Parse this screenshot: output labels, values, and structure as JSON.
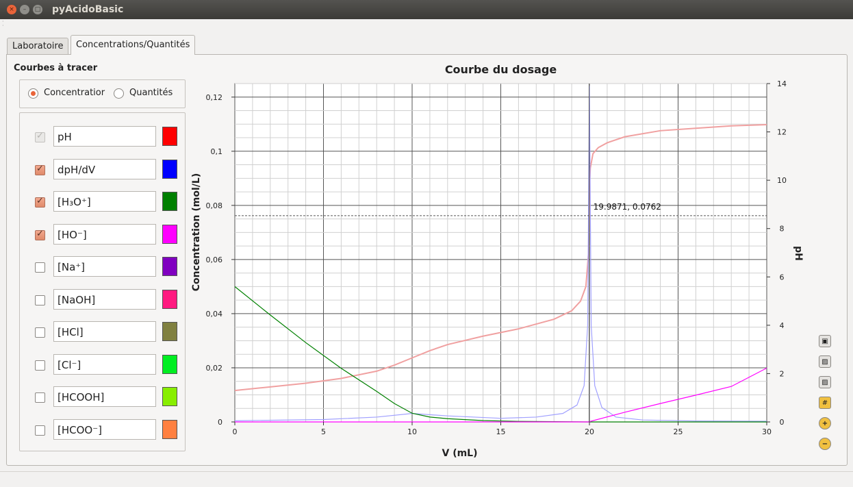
{
  "window": {
    "title": "pyAcidoBasic",
    "close": "×",
    "minimize": "–",
    "maximize": "□"
  },
  "tabs": [
    {
      "label": "Laboratoire",
      "active": false
    },
    {
      "label": "Concentrations/Quantités",
      "active": true
    }
  ],
  "sidebar": {
    "title": "Courbes à tracer",
    "mode": {
      "concentration_label": "Concentratior",
      "quantites_label": "Quantités",
      "selected": "concentration"
    },
    "curves": [
      {
        "label": "pH",
        "checked": true,
        "disabled": true,
        "color": "#ff0000"
      },
      {
        "label": "dpH/dV",
        "checked": true,
        "disabled": false,
        "color": "#0000ff"
      },
      {
        "label": "[H₃O⁺]",
        "checked": true,
        "disabled": false,
        "color": "#008000"
      },
      {
        "label": "[HO⁻]",
        "checked": true,
        "disabled": false,
        "color": "#ff00ff"
      },
      {
        "label": "[Na⁺]",
        "checked": false,
        "disabled": false,
        "color": "#8000c0"
      },
      {
        "label": "[NaOH]",
        "checked": false,
        "disabled": false,
        "color": "#ff1a80"
      },
      {
        "label": "[HCl]",
        "checked": false,
        "disabled": false,
        "color": "#808040"
      },
      {
        "label": "[Cl⁻]",
        "checked": false,
        "disabled": false,
        "color": "#00ee22"
      },
      {
        "label": "[HCOOH]",
        "checked": false,
        "disabled": false,
        "color": "#88ee00"
      },
      {
        "label": "[HCOO⁻]",
        "checked": false,
        "disabled": false,
        "color": "#ff8040"
      }
    ]
  },
  "chart_data": {
    "type": "line",
    "title": "Courbe du dosage",
    "xlabel": "V (mL)",
    "ylabel": "Concentration (mol/L)",
    "y2label": "pH",
    "xlim": [
      0,
      30
    ],
    "ylim": [
      0,
      0.125
    ],
    "y2lim": [
      0,
      14
    ],
    "xticks": [
      0,
      5,
      10,
      15,
      20,
      25,
      30
    ],
    "yticks": [
      0,
      0.02,
      0.04,
      0.06,
      0.08,
      0.1,
      0.12
    ],
    "ytick_labels": [
      "0",
      "0,02",
      "0,04",
      "0,06",
      "0,08",
      "0,1",
      "0,12"
    ],
    "y2ticks": [
      0,
      2,
      4,
      6,
      8,
      10,
      12,
      14
    ],
    "grid": true,
    "cursor": {
      "x": 19.9871,
      "y": 0.0762,
      "label": "19.9871, 0.0762"
    },
    "series": [
      {
        "color": "#f0a0a0",
        "axis": "y2",
        "x": [
          0,
          2,
          4,
          6,
          8,
          9,
          10,
          11,
          12,
          14,
          16,
          18,
          19,
          19.5,
          19.8,
          19.95,
          20,
          20.05,
          20.2,
          20.5,
          21,
          22,
          24,
          26,
          28,
          30
        ],
        "values": [
          1.3,
          1.45,
          1.6,
          1.8,
          2.1,
          2.35,
          2.65,
          2.95,
          3.2,
          3.55,
          3.85,
          4.25,
          4.6,
          5.0,
          5.6,
          7.0,
          9.7,
          10.5,
          11.1,
          11.35,
          11.55,
          11.8,
          12.05,
          12.15,
          12.25,
          12.3
        ]
      },
      {
        "color": "#a0a0ff",
        "axis": "y2",
        "x": [
          0,
          5,
          8,
          10,
          12,
          15,
          17,
          18.5,
          19.3,
          19.7,
          19.9,
          20,
          20.1,
          20.3,
          20.7,
          21.5,
          23,
          26,
          30
        ],
        "values": [
          0.05,
          0.1,
          0.2,
          0.35,
          0.25,
          0.15,
          0.2,
          0.35,
          0.7,
          1.5,
          4.0,
          13.9,
          4.0,
          1.5,
          0.6,
          0.2,
          0.08,
          0.04,
          0.03
        ]
      },
      {
        "color": "#008000",
        "axis": "y",
        "x": [
          0,
          2,
          4,
          6,
          8,
          9,
          10,
          11,
          12,
          14,
          16,
          18,
          20,
          22,
          25,
          30
        ],
        "values": [
          0.05,
          0.0395,
          0.0293,
          0.0198,
          0.0113,
          0.0068,
          0.0032,
          0.0018,
          0.0012,
          0.0005,
          0.0002,
          0.0001,
          0,
          0,
          0,
          0
        ]
      },
      {
        "color": "#ff00ff",
        "axis": "y",
        "x": [
          0,
          20,
          20.05,
          22,
          24,
          26,
          28,
          30
        ],
        "values": [
          0,
          0,
          0.0002,
          0.0036,
          0.0068,
          0.0099,
          0.0131,
          0.0199
        ]
      }
    ]
  }
}
